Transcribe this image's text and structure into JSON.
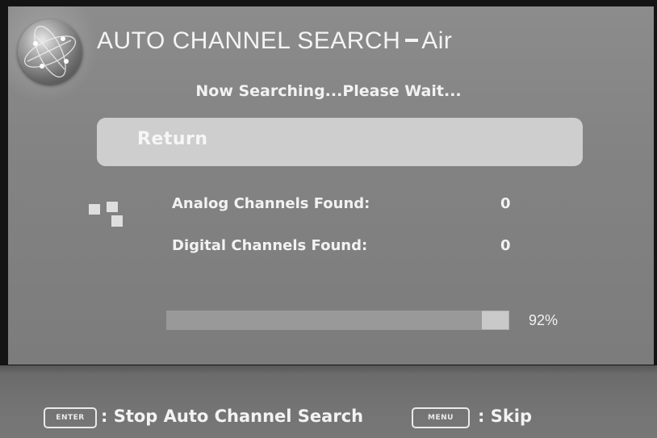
{
  "header": {
    "title": "AUTO CHANNEL SEARCH",
    "source": "Air",
    "icon": "globe-icon"
  },
  "status_text": "Now Searching...Please Wait...",
  "menu": {
    "return_label": "Return"
  },
  "results": {
    "icon": "channel-list-icon",
    "analog_label": "Analog Channels Found:",
    "analog_count": "0",
    "digital_label": "Digital Channels Found:",
    "digital_count": "0"
  },
  "progress": {
    "fraction": 0.92,
    "label": "92%"
  },
  "footer": {
    "enter_key": "ENTER",
    "enter_action": ": Stop Auto Channel Search",
    "menu_key": "MENU",
    "menu_action": ": Skip"
  }
}
